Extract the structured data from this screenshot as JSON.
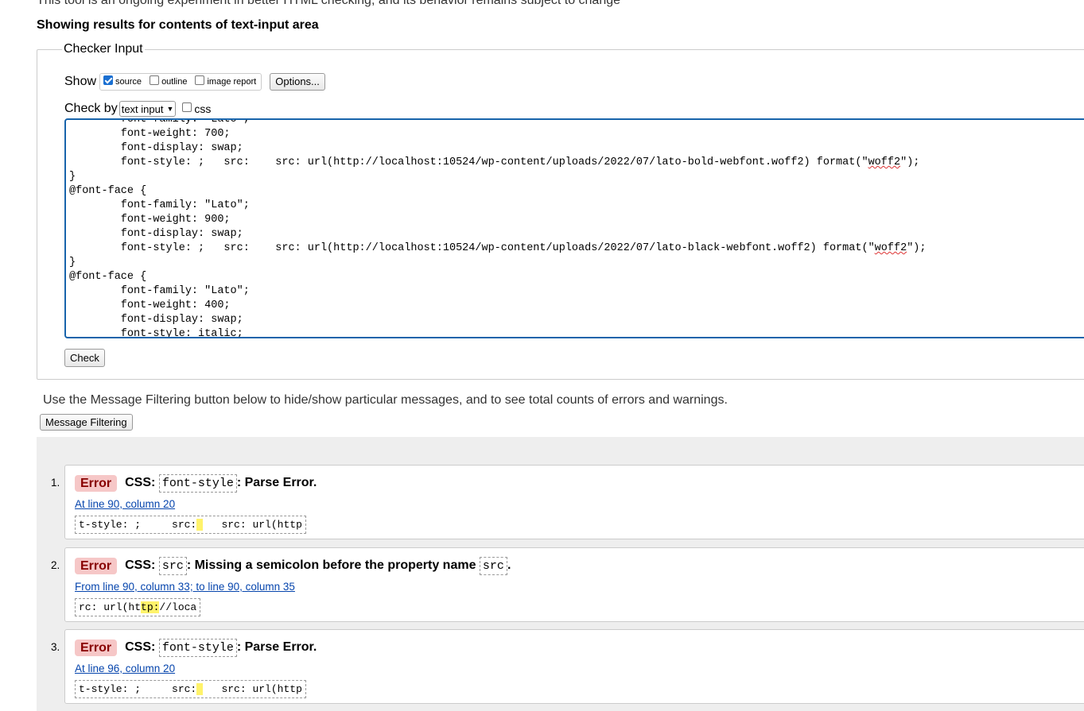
{
  "page": {
    "cut_line": "This tool is an ongoing experiment in better HTML checking, and its behavior remains subject to change",
    "results_heading": "Showing results for contents of text-input area"
  },
  "checker": {
    "legend": "Checker Input",
    "show_label": "Show",
    "show_options": [
      {
        "label": "source",
        "checked": true
      },
      {
        "label": "outline",
        "checked": false
      },
      {
        "label": "image report",
        "checked": false
      }
    ],
    "options_button": "Options...",
    "checkby_label": "Check by",
    "checkby_value": "text input",
    "css_label": "css",
    "css_checked": false,
    "check_button": "Check",
    "source_lines": [
      "        font-family: \"Lato\";",
      "        font-weight: 700;",
      "        font-display: swap;",
      "        font-style: ;   src:    src: url(http://localhost:10524/wp-content/uploads/2022/07/lato-bold-webfont.woff2) format(\"woff2\");",
      "}",
      "@font-face {",
      "        font-family: \"Lato\";",
      "        font-weight: 900;",
      "        font-display: swap;",
      "        font-style: ;   src:    src: url(http://localhost:10524/wp-content/uploads/2022/07/lato-black-webfont.woff2) format(\"woff2\");",
      "}",
      "@font-face {",
      "        font-family: \"Lato\";",
      "        font-weight: 400;",
      "        font-display: swap;",
      "        font-style: italic;"
    ]
  },
  "filtering": {
    "text": "Use the Message Filtering button below to hide/show particular messages, and to see total counts of errors and warnings.",
    "button": "Message Filtering"
  },
  "messages": [
    {
      "num": "1.",
      "type": "Error",
      "prefix": "CSS:",
      "code": "font-style",
      "text": ": Parse Error.",
      "code2": "",
      "text2": "",
      "location": "At line 90, column 20",
      "extract_before": "t-style: ;     src:",
      "extract_hl": " ",
      "extract_after": "   src: url(http"
    },
    {
      "num": "2.",
      "type": "Error",
      "prefix": "CSS:",
      "code": "src",
      "text": ": Missing a semicolon before the property name",
      "code2": "src",
      "text2": ".",
      "location": "From line 90, column 33; to line 90, column 35",
      "extract_before": "rc: url(ht",
      "extract_hl": "tp:",
      "extract_after": "//loca"
    },
    {
      "num": "3.",
      "type": "Error",
      "prefix": "CSS:",
      "code": "font-style",
      "text": ": Parse Error.",
      "code2": "",
      "text2": "",
      "location": "At line 96, column 20",
      "extract_before": "t-style: ;     src:",
      "extract_hl": " ",
      "extract_after": "   src: url(http"
    }
  ]
}
